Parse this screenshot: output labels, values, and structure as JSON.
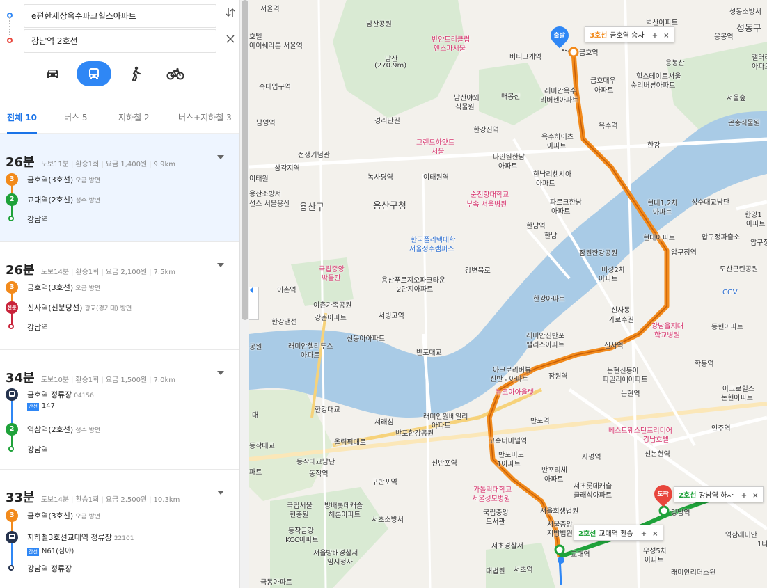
{
  "route": {
    "origin": "e편한세상옥수파크힐스아파트",
    "destination": "강남역 2호선",
    "swap_icon": "swap-vertical-icon",
    "clear_icon": "close-icon"
  },
  "modes": [
    {
      "name": "car",
      "icon": "car-icon",
      "active": false
    },
    {
      "name": "transit",
      "icon": "bus-icon",
      "active": true
    },
    {
      "name": "walk",
      "icon": "walk-icon",
      "active": false
    },
    {
      "name": "bike",
      "icon": "bike-icon",
      "active": false
    }
  ],
  "tabs": [
    {
      "label": "전체",
      "count": "10",
      "active": true
    },
    {
      "label": "버스",
      "count": "5",
      "active": false
    },
    {
      "label": "지하철",
      "count": "2",
      "active": false
    },
    {
      "label": "버스+지하철",
      "count": "3",
      "active": false
    }
  ],
  "results": [
    {
      "time": "26분",
      "walk": "도보11분",
      "transfer": "환승1회",
      "fare": "요금 1,400원",
      "distance": "9.9km",
      "steps": [
        {
          "type": "subway",
          "badge": "3",
          "color": "#f28a1b",
          "label": "금호역(3호선)",
          "sub": "오금 방면"
        },
        {
          "type": "subway",
          "badge": "2",
          "color": "#1fa23a",
          "label": "교대역(2호선)",
          "sub": "성수 방면"
        },
        {
          "type": "end",
          "color": "#1fa23a",
          "label": "강남역"
        }
      ]
    },
    {
      "time": "26분",
      "walk": "도보14분",
      "transfer": "환승1회",
      "fare": "요금 2,100원",
      "distance": "7.5km",
      "steps": [
        {
          "type": "subway",
          "badge": "3",
          "color": "#f28a1b",
          "label": "금호역(3호선)",
          "sub": "오금 방면"
        },
        {
          "type": "subway",
          "badge": "신분",
          "color": "#c8233a",
          "label": "신사역(신분당선)",
          "sub": "광교(경기대) 방면"
        },
        {
          "type": "end",
          "color": "#c8233a",
          "label": "강남역"
        }
      ]
    },
    {
      "time": "34분",
      "walk": "도보10분",
      "transfer": "환승1회",
      "fare": "요금 1,500원",
      "distance": "7.0km",
      "steps": [
        {
          "type": "bus",
          "color": "#27344f",
          "label": "금호역 정류장",
          "sub": "04156",
          "bus_tag": "간선",
          "bus_no": "147"
        },
        {
          "type": "subway",
          "badge": "2",
          "color": "#1fa23a",
          "label": "역삼역(2호선)",
          "sub": "성수 방면"
        },
        {
          "type": "end",
          "color": "#1fa23a",
          "label": "강남역"
        }
      ]
    },
    {
      "time": "33분",
      "walk": "도보14분",
      "transfer": "환승1회",
      "fare": "요금 2,500원",
      "distance": "10.3km",
      "steps": [
        {
          "type": "subway",
          "badge": "3",
          "color": "#f28a1b",
          "label": "금호역(3호선)",
          "sub": "오금 방면"
        },
        {
          "type": "bus",
          "color": "#27344f",
          "label": "지하철3호선교대역 정류장",
          "sub": "22101",
          "bus_tag": "간선",
          "bus_no": "N61(심야)"
        },
        {
          "type": "end",
          "color": "#27344f",
          "label": "강남역 정류장"
        }
      ]
    }
  ],
  "map": {
    "start_pin": "출발",
    "end_pin": "도착",
    "callouts": [
      {
        "line": "3호선",
        "text": "금호역 승차"
      },
      {
        "line": "2호선",
        "text": "강남역 하차"
      },
      {
        "line": "2호선",
        "text": "교대역 환승"
      }
    ],
    "callout_add": "+",
    "callout_close": "×",
    "labels": [
      {
        "t": "서울역",
        "c": ""
      },
      {
        "t": "남산공원",
        "c": ""
      },
      {
        "t": "반얀트리클럽",
        "c": "pink"
      },
      {
        "t": "앤스파서울",
        "c": "pink"
      },
      {
        "t": "남산",
        "c": ""
      },
      {
        "t": "(270.9m)",
        "c": ""
      },
      {
        "t": "버티고개역",
        "c": "stn"
      },
      {
        "t": "벽산아파트",
        "c": ""
      },
      {
        "t": "성동소방서",
        "c": ""
      },
      {
        "t": "성동구",
        "c": "big"
      },
      {
        "t": "응봉역",
        "c": "stn"
      },
      {
        "t": "금호역",
        "c": "stn"
      },
      {
        "t": "응봉산",
        "c": ""
      },
      {
        "t": "힐스테이트서울",
        "c": ""
      },
      {
        "t": "숲리버뷰아파트",
        "c": ""
      },
      {
        "t": "금호대우",
        "c": ""
      },
      {
        "t": "아파트",
        "c": ""
      },
      {
        "t": "래미안옥수",
        "c": ""
      },
      {
        "t": "리버젠아파트",
        "c": ""
      },
      {
        "t": "매봉산",
        "c": ""
      },
      {
        "t": "남산야외",
        "c": ""
      },
      {
        "t": "식물원",
        "c": ""
      },
      {
        "t": "숙대입구역",
        "c": "stn"
      },
      {
        "t": "경리단길",
        "c": ""
      },
      {
        "t": "한강진역",
        "c": "stn"
      },
      {
        "t": "옥수역",
        "c": "stn"
      },
      {
        "t": "그랜드하얏트",
        "c": "pink"
      },
      {
        "t": "서울",
        "c": "pink"
      },
      {
        "t": "옥수하이츠",
        "c": ""
      },
      {
        "t": "아파트",
        "c": ""
      },
      {
        "t": "서울숲",
        "c": ""
      },
      {
        "t": "곤충식물원",
        "c": ""
      },
      {
        "t": "남영역",
        "c": "stn"
      },
      {
        "t": "전쟁기념관",
        "c": ""
      },
      {
        "t": "삼각지역",
        "c": "stn"
      },
      {
        "t": "녹사평역",
        "c": "stn"
      },
      {
        "t": "이태원역",
        "c": "stn"
      },
      {
        "t": "나인원한남",
        "c": ""
      },
      {
        "t": "아파트",
        "c": ""
      },
      {
        "t": "한남리첸시아",
        "c": ""
      },
      {
        "t": "아파트",
        "c": ""
      },
      {
        "t": "순천향대학교",
        "c": "pink"
      },
      {
        "t": "부속 서울병원",
        "c": "pink"
      },
      {
        "t": "용산소방서",
        "c": ""
      },
      {
        "t": "용산구",
        "c": "big"
      },
      {
        "t": "용산구청",
        "c": ""
      },
      {
        "t": "파르크한남",
        "c": ""
      },
      {
        "t": "아파트",
        "c": ""
      },
      {
        "t": "현대1,2차",
        "c": ""
      },
      {
        "t": "아파트",
        "c": ""
      },
      {
        "t": "성수대교남단",
        "c": ""
      },
      {
        "t": "한강",
        "c": ""
      },
      {
        "t": "한남역",
        "c": "stn"
      },
      {
        "t": "압구정파출소",
        "c": ""
      },
      {
        "t": "한국폴리텍대학",
        "c": "blue"
      },
      {
        "t": "서울정수캠퍼스",
        "c": "blue"
      },
      {
        "t": "현대아파트",
        "c": ""
      },
      {
        "t": "압구정역",
        "c": "stn"
      },
      {
        "t": "잠원한강공원",
        "c": ""
      },
      {
        "t": "국립중앙",
        "c": "pink"
      },
      {
        "t": "박물관",
        "c": "pink"
      },
      {
        "t": "미성2차",
        "c": ""
      },
      {
        "t": "아파트",
        "c": ""
      },
      {
        "t": "도산근린공원",
        "c": ""
      },
      {
        "t": "이촌역",
        "c": "stn"
      },
      {
        "t": "용산푸르지오파크타운",
        "c": ""
      },
      {
        "t": "2단지아파트",
        "c": ""
      },
      {
        "t": "CGV",
        "c": "blue"
      },
      {
        "t": "한강아파트",
        "c": ""
      },
      {
        "t": "이촌가족공원",
        "c": ""
      },
      {
        "t": "서빙고역",
        "c": "stn"
      },
      {
        "t": "신사동",
        "c": ""
      },
      {
        "t": "가로수길",
        "c": ""
      },
      {
        "t": "한강맨션",
        "c": ""
      },
      {
        "t": "강촌아파트",
        "c": ""
      },
      {
        "t": "강남을지대",
        "c": "pink"
      },
      {
        "t": "학교병원",
        "c": "pink"
      },
      {
        "t": "동현아파트",
        "c": ""
      },
      {
        "t": "신동아아파트",
        "c": ""
      },
      {
        "t": "래미안신반포",
        "c": ""
      },
      {
        "t": "팰리스아파트",
        "c": ""
      },
      {
        "t": "신사역",
        "c": "stn"
      },
      {
        "t": "래미안첼리투스",
        "c": ""
      },
      {
        "t": "아파트",
        "c": ""
      },
      {
        "t": "학동역",
        "c": "stn"
      },
      {
        "t": "아크로리버뷰",
        "c": ""
      },
      {
        "t": "신반포아파트",
        "c": ""
      },
      {
        "t": "잠원역",
        "c": "stn"
      },
      {
        "t": "논현신동아",
        "c": ""
      },
      {
        "t": "파밀리에아파트",
        "c": ""
      },
      {
        "t": "뉴코아아울렛",
        "c": "pink"
      },
      {
        "t": "논현역",
        "c": "stn"
      },
      {
        "t": "아크로힐스",
        "c": ""
      },
      {
        "t": "논현아파트",
        "c": ""
      },
      {
        "t": "반포역",
        "c": "stn"
      },
      {
        "t": "서래섬",
        "c": ""
      },
      {
        "t": "래미안원베일리",
        "c": ""
      },
      {
        "t": "아파트",
        "c": ""
      },
      {
        "t": "반포한강공원",
        "c": ""
      },
      {
        "t": "베스트웨스턴프리미어",
        "c": "pink"
      },
      {
        "t": "강남호텔",
        "c": "pink"
      },
      {
        "t": "언주역",
        "c": "stn"
      },
      {
        "t": "올림픽대로",
        "c": ""
      },
      {
        "t": "고속터미널역",
        "c": "stn"
      },
      {
        "t": "사평역",
        "c": "stn"
      },
      {
        "t": "신논현역",
        "c": "stn"
      },
      {
        "t": "동작대교남단",
        "c": ""
      },
      {
        "t": "신반포역",
        "c": "stn"
      },
      {
        "t": "반포미도",
        "c": ""
      },
      {
        "t": "1아파트",
        "c": ""
      },
      {
        "t": "반포리체",
        "c": ""
      },
      {
        "t": "아파트",
        "c": ""
      },
      {
        "t": "동작역",
        "c": "stn"
      },
      {
        "t": "구반포역",
        "c": "stn"
      },
      {
        "t": "가톨릭대학교",
        "c": "pink"
      },
      {
        "t": "서울성모병원",
        "c": "pink"
      },
      {
        "t": "서초롯데캐슬",
        "c": ""
      },
      {
        "t": "클래식아파트",
        "c": ""
      },
      {
        "t": "국립서울",
        "c": ""
      },
      {
        "t": "현충원",
        "c": ""
      },
      {
        "t": "방배롯데캐슬",
        "c": ""
      },
      {
        "t": "헤론아파트",
        "c": ""
      },
      {
        "t": "국립중앙",
        "c": ""
      },
      {
        "t": "도서관",
        "c": ""
      },
      {
        "t": "서울회생법원",
        "c": ""
      },
      {
        "t": "서울중앙",
        "c": ""
      },
      {
        "t": "지방법원",
        "c": ""
      },
      {
        "t": "강남역",
        "c": "stn"
      },
      {
        "t": "서초소방서",
        "c": ""
      },
      {
        "t": "동작금강",
        "c": ""
      },
      {
        "t": "KCC아파트",
        "c": ""
      },
      {
        "t": "역삼래미안",
        "c": ""
      },
      {
        "t": "서초경찰서",
        "c": ""
      },
      {
        "t": "교대역",
        "c": "stn"
      },
      {
        "t": "우성5차",
        "c": ""
      },
      {
        "t": "아파트",
        "c": ""
      },
      {
        "t": "서울방배경찰서",
        "c": ""
      },
      {
        "t": "임시청사",
        "c": ""
      },
      {
        "t": "래미안리더스원",
        "c": ""
      },
      {
        "t": "대법원",
        "c": ""
      },
      {
        "t": "서초역",
        "c": "stn"
      },
      {
        "t": "극동아파트",
        "c": ""
      },
      {
        "t": "갤러리",
        "c": ""
      },
      {
        "t": "아파트",
        "c": ""
      },
      {
        "t": "한양1",
        "c": ""
      },
      {
        "t": "아파트",
        "c": ""
      },
      {
        "t": "이태원",
        "c": ""
      },
      {
        "t": "선스 서울용산",
        "c": ""
      },
      {
        "t": "호텔",
        "c": ""
      },
      {
        "t": "아이쉐라톤 서울역",
        "c": ""
      },
      {
        "t": "한남",
        "c": ""
      },
      {
        "t": "압구정로",
        "c": ""
      },
      {
        "t": "1타",
        "c": ""
      },
      {
        "t": "파트",
        "c": ""
      },
      {
        "t": "공원",
        "c": ""
      },
      {
        "t": "동작대교",
        "c": ""
      },
      {
        "t": "대",
        "c": ""
      },
      {
        "t": "반포대교",
        "c": ""
      },
      {
        "t": "한강대교",
        "c": ""
      },
      {
        "t": "강변북로",
        "c": ""
      }
    ]
  }
}
